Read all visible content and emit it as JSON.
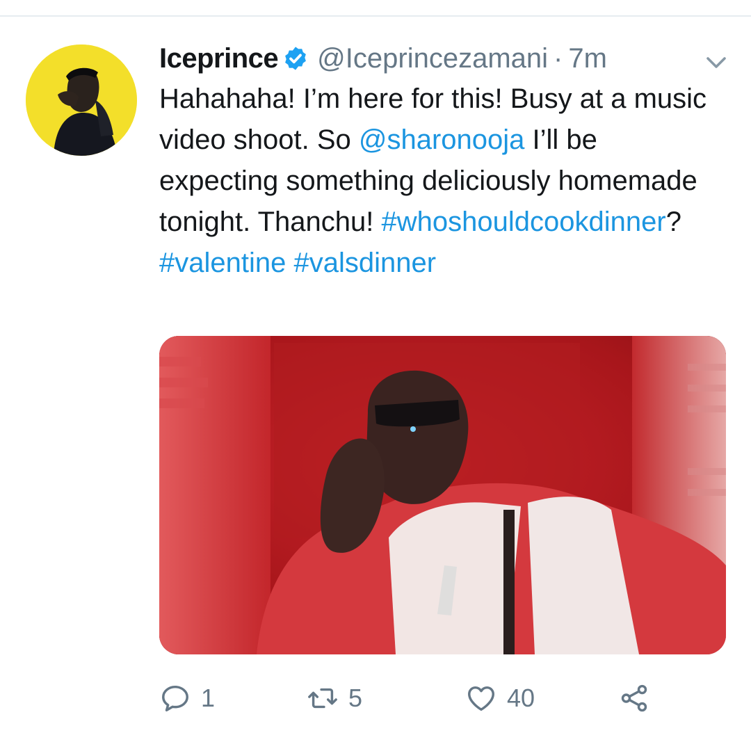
{
  "tweet": {
    "display_name": "Iceprince",
    "handle": "@Iceprincezamani",
    "separator": "·",
    "time": "7m",
    "text": {
      "part1": "Hahahaha! I’m here for this! Busy at a music video shoot. So ",
      "mention": "@sharonooja",
      "part2": " I’ll be expecting something deliciously homemade tonight. Thanchu! ",
      "hashtag1": "#whoshouldcookdinner",
      "part3": "? ",
      "hashtag2": "#valentine",
      "space": " ",
      "hashtag3": "#valsdinner"
    }
  },
  "actions": {
    "reply_count": "1",
    "retweet_count": "5",
    "like_count": "40"
  },
  "colors": {
    "link": "#1b95e0",
    "muted": "#657786",
    "verified": "#1da1f2",
    "avatar_bg": "#f3df2a",
    "media_bg": "#b5191c"
  },
  "icons": [
    "verified-badge-icon",
    "chevron-down-icon",
    "reply-icon",
    "retweet-icon",
    "like-icon",
    "share-icon"
  ]
}
